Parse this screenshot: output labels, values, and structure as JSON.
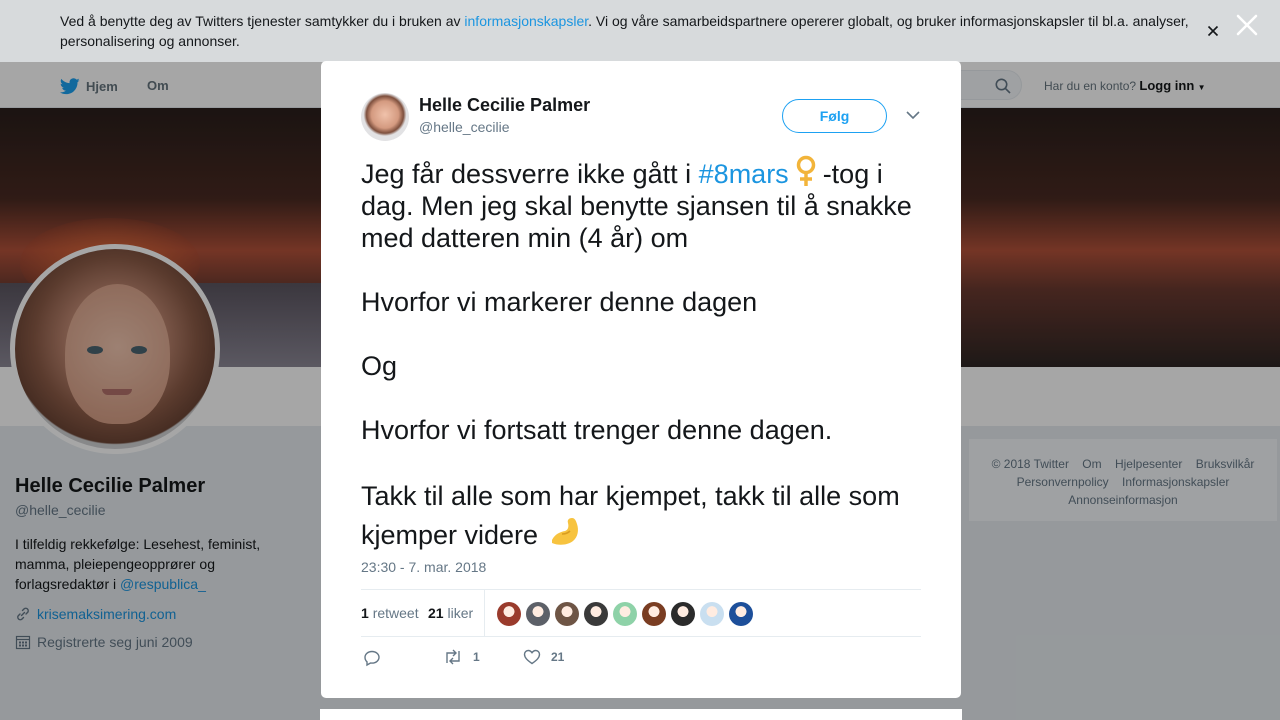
{
  "cookie_banner": {
    "text_before": "Ved å benytte deg av Twitters tjenester samtykker du i bruken av ",
    "link": "informasjonskapsler",
    "text_after": ". Vi og våre samarbeidspartnere opererer globalt, og bruker informasjonskapsler til bl.a. analyser, personalisering og annonser."
  },
  "topnav": {
    "home": "Hjem",
    "about": "Om",
    "account_question": "Har du en konto?",
    "login": "Logg inn"
  },
  "profile": {
    "name": "Helle Cecilie Palmer",
    "handle": "@helle_cecilie",
    "bio_text": "I tilfeldig rekkefølge: Lesehest, feminist, mamma, pleiepengeopprører og forlagsredaktør i ",
    "bio_link": "@respublica_",
    "website": "krisemaksimering.com",
    "joined": "Registrerte seg juni 2009"
  },
  "footer": {
    "links": [
      "© 2018 Twitter",
      "Om",
      "Hjelpesenter",
      "Bruksvilkår",
      "Personvernpolicy",
      "Informasjonskapsler",
      "Annonseinformasjon"
    ]
  },
  "tweet": {
    "author_name": "Helle Cecilie Palmer",
    "author_handle": "@helle_cecilie",
    "follow_label": "Følg",
    "line1_before": "Jeg får dessverre ikke gått i ",
    "hashtag": "#8mars",
    "line1_after": "-tog i dag. Men jeg skal benytte sjansen til å snakke med datteren min (4 år) om",
    "para2": "Hvorfor vi markerer denne dagen",
    "para3": "Og",
    "para4": "Hvorfor vi fortsatt trenger denne dagen.",
    "para5": "Takk til alle som har kjempet, takk til alle som kjemper videre",
    "timestamp": "23:30 - 7. mar. 2018",
    "retweet_count": "1",
    "retweet_label": "retweet",
    "like_count": "21",
    "like_label": "liker",
    "action_retweets": "1",
    "action_likes": "21"
  },
  "colors": {
    "accent": "#1da1f2",
    "link": "#1b95e0",
    "muted": "#657786"
  },
  "liker_avatar_colors": [
    "#9a3b2c",
    "#5c6068",
    "#6e5545",
    "#3a3a3a",
    "#8ed2a8",
    "#7a3d22",
    "#2b2b2b",
    "#c9dff0",
    "#1d4f9a"
  ]
}
